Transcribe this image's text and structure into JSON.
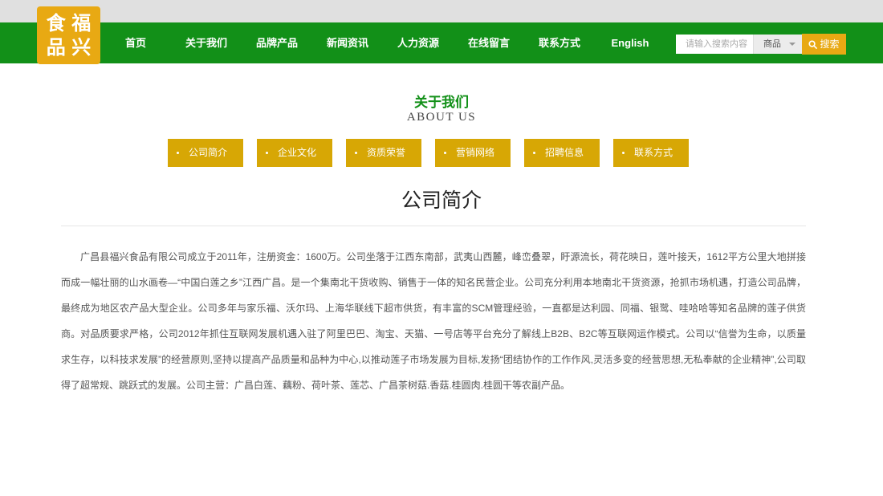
{
  "logo": {
    "chars": [
      "食",
      "福",
      "品",
      "兴"
    ]
  },
  "nav": {
    "items": [
      "首页",
      "关于我们",
      "品牌产品",
      "新闻资讯",
      "人力资源",
      "在线留言",
      "联系方式",
      "English"
    ]
  },
  "search": {
    "placeholder": "请输入搜索内容",
    "category": "商品",
    "button_label": "搜索"
  },
  "section": {
    "title_cn": "关于我们",
    "title_en": "ABOUT US"
  },
  "subnav": {
    "items": [
      "公司简介",
      "企业文化",
      "资质荣誉",
      "营销网络",
      "招聘信息",
      "联系方式"
    ]
  },
  "page": {
    "heading": "公司简介",
    "body": "广昌县福兴食品有限公司成立于2011年，注册资金：1600万。公司坐落于江西东南部，武夷山西麓，峰峦叠翠，盱源流长，荷花映日，莲叶接天，1612平方公里大地拼接而成一幅壮丽的山水画卷—“中国白莲之乡”江西广昌。是一个集南北干货收购、销售于一体的知名民营企业。公司充分利用本地南北干货资源，抢抓市场机遇，打造公司品牌，最终成为地区农产品大型企业。公司多年与家乐福、沃尔玛、上海华联线下超市供货，有丰富的SCM管理经验，一直都是达利园、同福、银鹭、哇哈哈等知名品牌的莲子供货商。对品质要求严格，公司2012年抓住互联网发展机遇入驻了阿里巴巴、淘宝、天猫、一号店等平台充分了解线上B2B、B2C等互联网运作模式。公司以“信誉为生命，以质量求生存，以科技求发展”的经营原则,坚持以提高产品质量和品种为中心,以推动莲子市场发展为目标,发扬“团结协作的工作作风,灵活多变的经营思想,无私奉献的企业精神”,公司取得了超常规、跳跃式的发展。公司主营：广昌白莲、藕粉、荷叶茶、莲芯、广昌茶树菇.香菇.桂圆肉.桂圆干等农副产品。"
  },
  "colors": {
    "brand_green": "#129018",
    "brand_yellow": "#e8a913",
    "subnav_yellow": "#d7a705"
  }
}
